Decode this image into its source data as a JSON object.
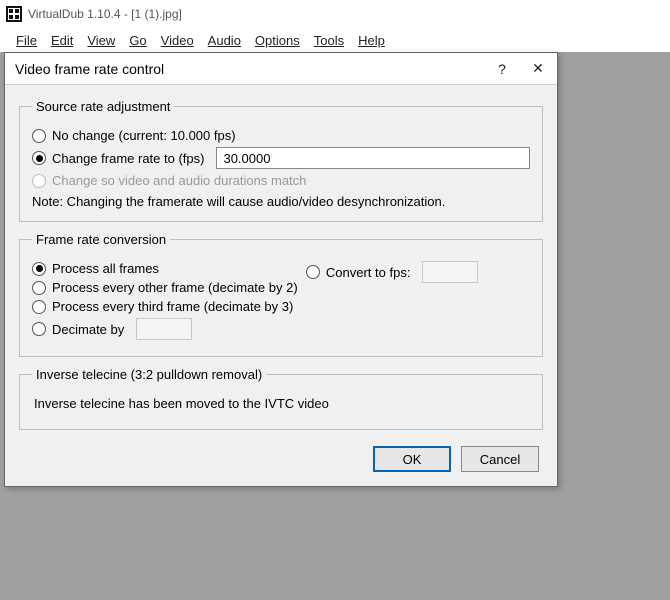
{
  "app": {
    "title": "VirtualDub 1.10.4 - [1 (1).jpg]"
  },
  "menu": {
    "file": "File",
    "edit": "Edit",
    "view": "View",
    "go": "Go",
    "video": "Video",
    "audio": "Audio",
    "options": "Options",
    "tools": "Tools",
    "help": "Help"
  },
  "dialog": {
    "title": "Video frame rate control",
    "help_glyph": "?",
    "close_glyph": "✕",
    "source": {
      "legend": "Source rate adjustment",
      "no_change": "No change (current: 10.000 fps)",
      "change_to": "Change frame rate to (fps)",
      "change_to_value": "30.0000",
      "match_av": "Change so video and audio durations match",
      "note": "Note: Changing the framerate will cause audio/video desynchronization."
    },
    "conversion": {
      "legend": "Frame rate conversion",
      "process_all": "Process all frames",
      "decimate2": "Process every other frame (decimate by 2)",
      "decimate3": "Process every third frame (decimate by 3)",
      "decimate_by": "Decimate by",
      "decimate_by_value": "",
      "convert_to": "Convert to fps:",
      "convert_to_value": ""
    },
    "ivtc": {
      "legend": "Inverse telecine (3:2 pulldown removal)",
      "text": "Inverse telecine has been moved to the IVTC video"
    },
    "buttons": {
      "ok": "OK",
      "cancel": "Cancel"
    }
  }
}
